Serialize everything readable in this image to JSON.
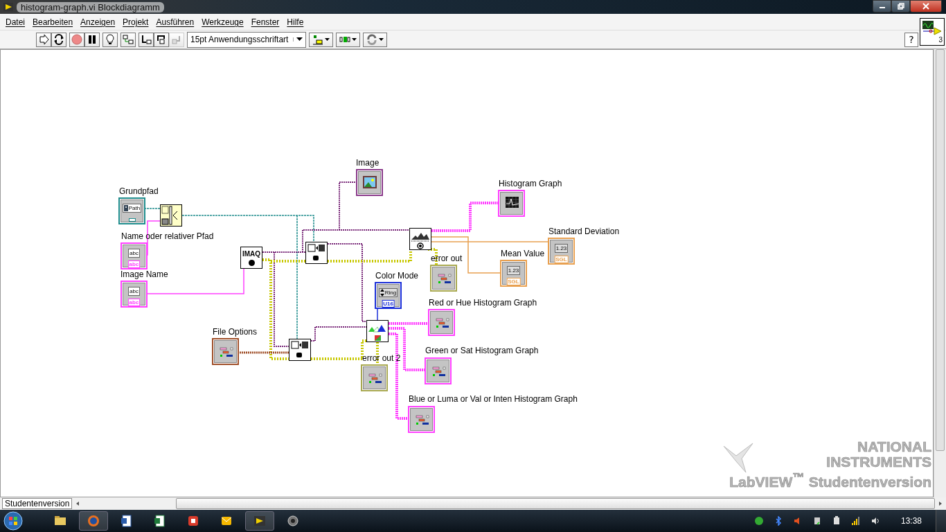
{
  "window": {
    "title": "histogram-graph.vi Blockdiagramm"
  },
  "menu": [
    {
      "label": "Datei"
    },
    {
      "label": "Bearbeiten"
    },
    {
      "label": "Anzeigen"
    },
    {
      "label": "Projekt"
    },
    {
      "label": "Ausführen"
    },
    {
      "label": "Werkzeuge"
    },
    {
      "label": "Fenster"
    },
    {
      "label": "Hilfe"
    }
  ],
  "toolbar": {
    "font_dropdown": "15pt Anwendungsschriftart",
    "help_button": "?",
    "connector_pane": "3"
  },
  "diagram": {
    "terminals": [
      {
        "label": "Grundpfad",
        "kind": "path",
        "color": "#1e8c8c",
        "value": "Path"
      },
      {
        "label": "Name oder relativer Pfad",
        "kind": "string",
        "color": "#ff40ff",
        "value": "abc",
        "tag": "abc"
      },
      {
        "label": "Image Name",
        "kind": "string",
        "color": "#ff40ff",
        "value": "abc",
        "tag": "abc"
      },
      {
        "label": "Image",
        "kind": "image",
        "color": "#8a3a8a"
      },
      {
        "label": "Histogram Graph",
        "kind": "graph",
        "color": "#ff40ff"
      },
      {
        "label": "Standard  Deviation",
        "kind": "numeric",
        "color": "#e8a050",
        "value": "1.23",
        "tag": "SGL"
      },
      {
        "label": "Mean Value",
        "kind": "numeric",
        "color": "#e8a050",
        "value": "1.23",
        "tag": "SGL"
      },
      {
        "label": "error out",
        "kind": "cluster",
        "color": "#a8a850"
      },
      {
        "label": "Color Mode",
        "kind": "ring",
        "color": "#1a2ed8",
        "value": "Ring",
        "tag": "U16"
      },
      {
        "label": "Red or Hue Histogram Graph",
        "kind": "cluster",
        "color": "#ff40ff"
      },
      {
        "label": "Green or Sat Histogram Graph",
        "kind": "cluster",
        "color": "#ff40ff"
      },
      {
        "label": "error out 2",
        "kind": "cluster",
        "color": "#a8a850"
      },
      {
        "label": "Blue or Luma or Val or Inten Histogram Graph",
        "kind": "cluster",
        "color": "#ff40ff"
      },
      {
        "label": "File Options",
        "kind": "cluster",
        "color": "#a0502a"
      }
    ],
    "functions": [
      {
        "kind": "build_path"
      },
      {
        "kind": "imaq_create",
        "text": "IMAQ"
      },
      {
        "kind": "file_read"
      },
      {
        "kind": "histogram"
      },
      {
        "kind": "color_histogram"
      },
      {
        "kind": "file_info"
      }
    ]
  },
  "watermark": {
    "line_1": "NATIONAL",
    "line_2": "INSTRUMENTS",
    "line_3": "LabVIEW$^{™}$ Studentenversion"
  },
  "status_bar": {
    "context": "Studentenversion"
  },
  "taskbar": {
    "clock": "13:38"
  }
}
